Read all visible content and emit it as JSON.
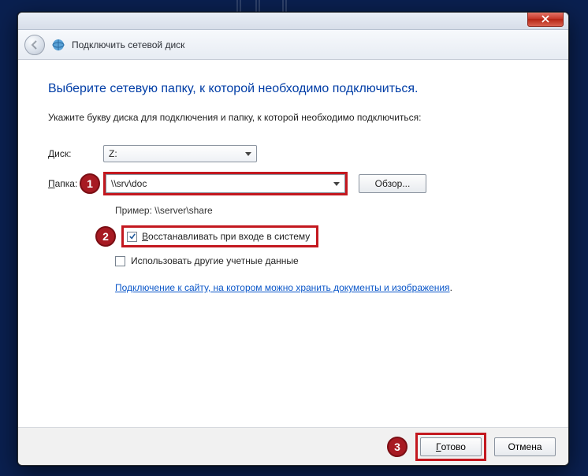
{
  "window": {
    "title": "Подключить сетевой диск"
  },
  "dialog": {
    "heading": "Выберите сетевую папку, к которой необходимо подключиться.",
    "subheading": "Укажите букву диска для подключения и папку, к которой необходимо подключиться:",
    "drive_label": "Диск:",
    "drive_value": "Z:",
    "folder_label": "Папка:",
    "folder_value": "\\\\srv\\doc",
    "browse_label": "Обзор...",
    "example": "Пример: \\\\server\\share",
    "reconnect_label": "Восстанавливать при входе в систему",
    "other_creds_label": "Использовать другие учетные данные",
    "link_text": "Подключение к сайту, на котором можно хранить документы и изображения",
    "finish_label": "Готово",
    "cancel_label": "Отмена"
  },
  "callouts": {
    "c1": "1",
    "c2": "2",
    "c3": "3"
  }
}
